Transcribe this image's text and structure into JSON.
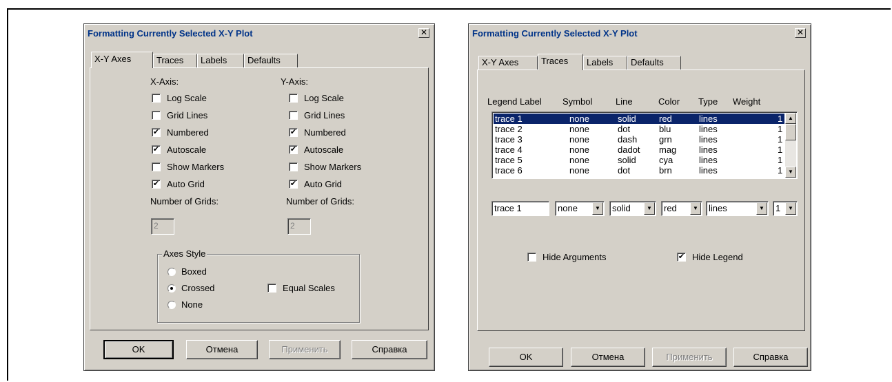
{
  "dialog1": {
    "title": "Formatting Currently Selected X-Y Plot",
    "close_glyph": "✕",
    "tabs": [
      "X-Y Axes",
      "Traces",
      "Labels",
      "Defaults"
    ],
    "x_axis": {
      "heading": "X-Axis:",
      "options": [
        {
          "label": "Log Scale",
          "checked": false
        },
        {
          "label": "Grid Lines",
          "checked": false
        },
        {
          "label": "Numbered",
          "checked": true
        },
        {
          "label": "Autoscale",
          "checked": true
        },
        {
          "label": "Show Markers",
          "checked": false
        },
        {
          "label": "Auto Grid",
          "checked": true
        }
      ],
      "grids_label": "Number of Grids:",
      "grids_value": "2"
    },
    "y_axis": {
      "heading": "Y-Axis:",
      "options": [
        {
          "label": "Log Scale",
          "checked": false
        },
        {
          "label": "Grid Lines",
          "checked": false
        },
        {
          "label": "Numbered",
          "checked": true
        },
        {
          "label": "Autoscale",
          "checked": true
        },
        {
          "label": "Show Markers",
          "checked": false
        },
        {
          "label": "Auto Grid",
          "checked": true
        }
      ],
      "grids_label": "Number of Grids:",
      "grids_value": "2"
    },
    "axes_style": {
      "title": "Axes Style",
      "options": [
        {
          "label": "Boxed",
          "selected": false
        },
        {
          "label": "Crossed",
          "selected": true
        },
        {
          "label": "None",
          "selected": false
        }
      ],
      "equal_scales": {
        "label": "Equal Scales",
        "checked": false
      }
    },
    "buttons": {
      "ok": "OK",
      "cancel": "Отмена",
      "apply": "Применить",
      "help": "Справка"
    }
  },
  "dialog2": {
    "title": "Formatting Currently Selected X-Y Plot",
    "close_glyph": "✕",
    "tabs": [
      "X-Y Axes",
      "Traces",
      "Labels",
      "Defaults"
    ],
    "columns": [
      "Legend Label",
      "Symbol",
      "Line",
      "Color",
      "Type",
      "Weight"
    ],
    "rows": [
      {
        "label": "trace 1",
        "symbol": "none",
        "line": "solid",
        "color": "red",
        "type": "lines",
        "weight": "1"
      },
      {
        "label": "trace 2",
        "symbol": "none",
        "line": "dot",
        "color": "blu",
        "type": "lines",
        "weight": "1"
      },
      {
        "label": "trace 3",
        "symbol": "none",
        "line": "dash",
        "color": "grn",
        "type": "lines",
        "weight": "1"
      },
      {
        "label": "trace 4",
        "symbol": "none",
        "line": "dadot",
        "color": "mag",
        "type": "lines",
        "weight": "1"
      },
      {
        "label": "trace 5",
        "symbol": "none",
        "line": "solid",
        "color": "cya",
        "type": "lines",
        "weight": "1"
      },
      {
        "label": "trace 6",
        "symbol": "none",
        "line": "dot",
        "color": "brn",
        "type": "lines",
        "weight": "1"
      }
    ],
    "editor": {
      "label": "trace 1",
      "symbol": "none",
      "line": "solid",
      "color": "red",
      "type": "lines",
      "weight": "1"
    },
    "hide_arguments": {
      "label": "Hide Arguments",
      "checked": false
    },
    "hide_legend": {
      "label": "Hide Legend",
      "checked": true
    },
    "buttons": {
      "ok": "OK",
      "cancel": "Отмена",
      "apply": "Применить",
      "help": "Справка"
    }
  },
  "colors": {
    "face": "#d4d0c8",
    "selection": "#0a246a",
    "title_text": "#003388"
  },
  "glyphs": {
    "check": "✔",
    "arrow_down": "▼",
    "arrow_up": "▲"
  }
}
